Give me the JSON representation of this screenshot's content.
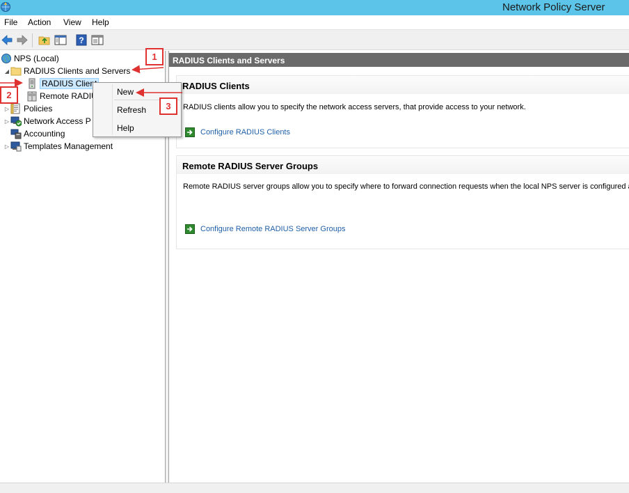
{
  "window": {
    "title": "Network Policy Server"
  },
  "menu": [
    "File",
    "Action",
    "View",
    "Help"
  ],
  "toolbar": [
    "back-icon",
    "forward-icon",
    "up-folder-icon",
    "show-hide-tree-icon",
    "help-icon",
    "properties-icon"
  ],
  "tree": {
    "root": "NPS (Local)",
    "radius_clients_and_servers": "RADIUS Clients and Servers",
    "radius_clients": "RADIUS Client",
    "remote_radius": "Remote RADIU",
    "policies": "Policies",
    "network_access": "Network Access P",
    "accounting": "Accounting",
    "templates": "Templates Management"
  },
  "context_menu": {
    "new": "New",
    "refresh": "Refresh",
    "help": "Help"
  },
  "right": {
    "header": "RADIUS Clients and Servers",
    "clients": {
      "title": "RADIUS Clients",
      "description": "RADIUS clients allow you to specify the network access servers, that provide access to your network.",
      "link": "Configure RADIUS Clients"
    },
    "groups": {
      "title": "Remote RADIUS Server Groups",
      "description": "Remote RADIUS server groups allow you to specify where to forward connection requests when the local NPS server is configured as a",
      "link": "Configure Remote RADIUS Server Groups"
    }
  },
  "callouts": [
    "1",
    "2",
    "3"
  ],
  "colors": {
    "annotation": "#e03131",
    "link": "#1f5fa8",
    "titlebar": "#5cc4e8"
  }
}
